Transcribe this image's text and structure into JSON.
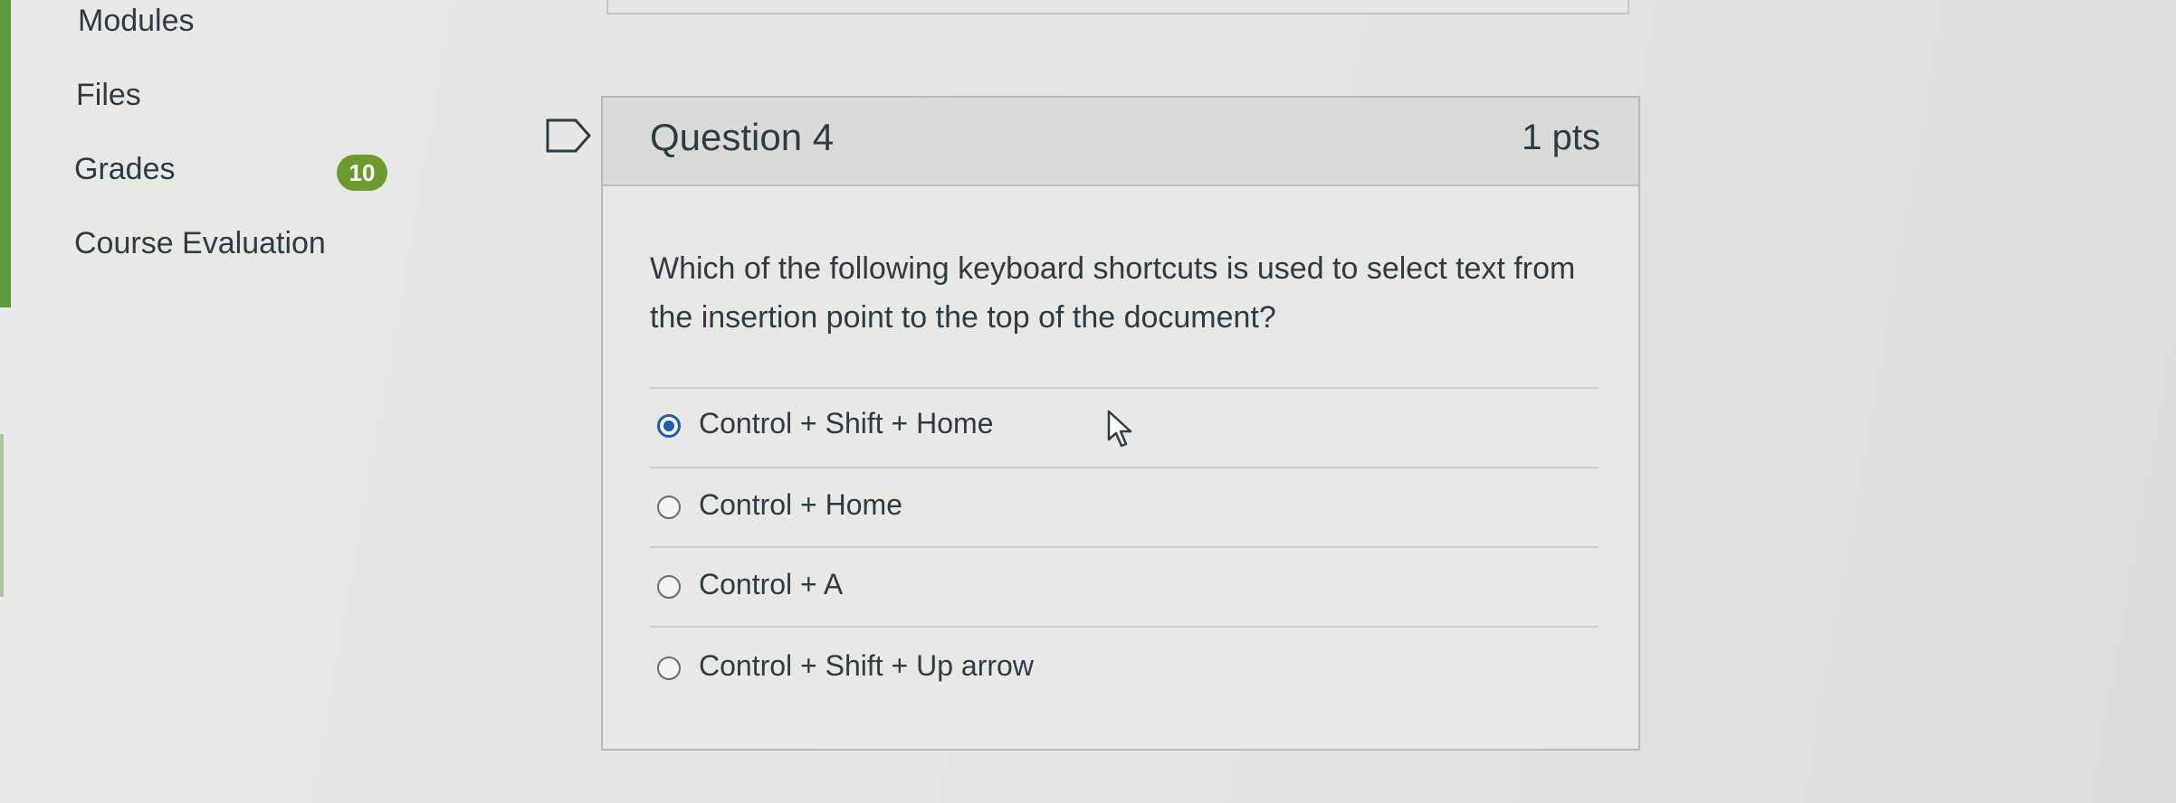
{
  "sidebar": {
    "items": [
      {
        "label": "Modules"
      },
      {
        "label": "Files"
      },
      {
        "label": "Grades",
        "badge": "10"
      },
      {
        "label": "Course Evaluation"
      }
    ]
  },
  "question": {
    "title": "Question 4",
    "points": "1 pts",
    "text": "Which of the following keyboard shortcuts is used to select text from the insertion point to the top of the document?",
    "answers": [
      {
        "label": "Control + Shift + Home",
        "selected": true
      },
      {
        "label": "Control + Home",
        "selected": false
      },
      {
        "label": "Control + A",
        "selected": false
      },
      {
        "label": "Control + Shift + Up arrow",
        "selected": false
      }
    ]
  },
  "icons": {
    "flag": "flag-outline-icon",
    "cursor": "mouse-pointer-icon"
  },
  "colors": {
    "selected_radio": "#1f5fa8",
    "badge": "#6c9a2c",
    "text": "#2d3b45",
    "left_accent": "#5c9a3c"
  }
}
